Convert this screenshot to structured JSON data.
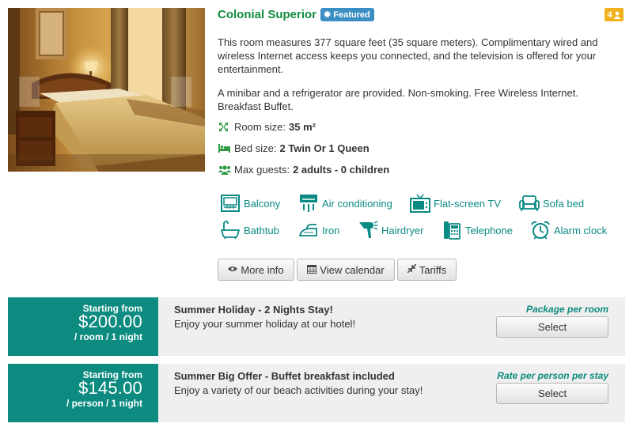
{
  "room": {
    "name": "Colonial Superior",
    "featured_label": "Featured",
    "guest_badge": "4",
    "description_1": "This room measures 377 square feet (35 square meters). Complimentary wired and wireless Internet access keeps you connected, and the television is offered for your entertainment.",
    "description_2": "A minibar and a refrigerator are provided. Non-smoking. Free Wireless Internet. Breakfast Buffet."
  },
  "specs": {
    "room_size_label": "Room size:",
    "room_size_value": "35 m²",
    "bed_size_label": "Bed size:",
    "bed_size_value": "2 Twin Or 1 Queen",
    "max_guests_label": "Max guests:",
    "max_guests_value": "2 adults - 0 children"
  },
  "amenities": {
    "balcony": "Balcony",
    "air_conditioning": "Air conditioning",
    "flat_screen_tv": "Flat-screen TV",
    "sofa_bed": "Sofa bed",
    "bathtub": "Bathtub",
    "iron": "Iron",
    "hairdryer": "Hairdryer",
    "telephone": "Telephone",
    "alarm_clock": "Alarm clock"
  },
  "actions": {
    "more_info": "More info",
    "view_calendar": "View calendar",
    "tariffs": "Tariffs"
  },
  "offers": [
    {
      "from_label": "Starting from",
      "price": "$200.00",
      "unit": "/ room / 1 night",
      "title": "Summer Holiday - 2 Nights Stay!",
      "description": "Enjoy your summer holiday at our hotel!",
      "type": "Package per room",
      "select_label": "Select"
    },
    {
      "from_label": "Starting from",
      "price": "$145.00",
      "unit": "/ person / 1 night",
      "title": "Summer Big Offer - Buffet breakfast included",
      "description": "Enjoy a variety of our beach activities during your stay!",
      "type": "Rate per person per stay",
      "select_label": "Select"
    }
  ],
  "colors": {
    "accent_green": "#128c3e",
    "teal": "#0d8b80",
    "featured_blue": "#3b8ec3",
    "badge_gold": "#f2b21d"
  },
  "icons": [
    "hotel-room-photo",
    "gear-icon",
    "users-icon",
    "expand-icon",
    "bed-icon",
    "group-icon",
    "balcony-icon",
    "air-conditioning-icon",
    "tv-icon",
    "sofa-icon",
    "bathtub-icon",
    "iron-icon",
    "hairdryer-icon",
    "telephone-icon",
    "alarm-clock-icon",
    "eye-icon",
    "calendar-icon",
    "compress-icon"
  ]
}
